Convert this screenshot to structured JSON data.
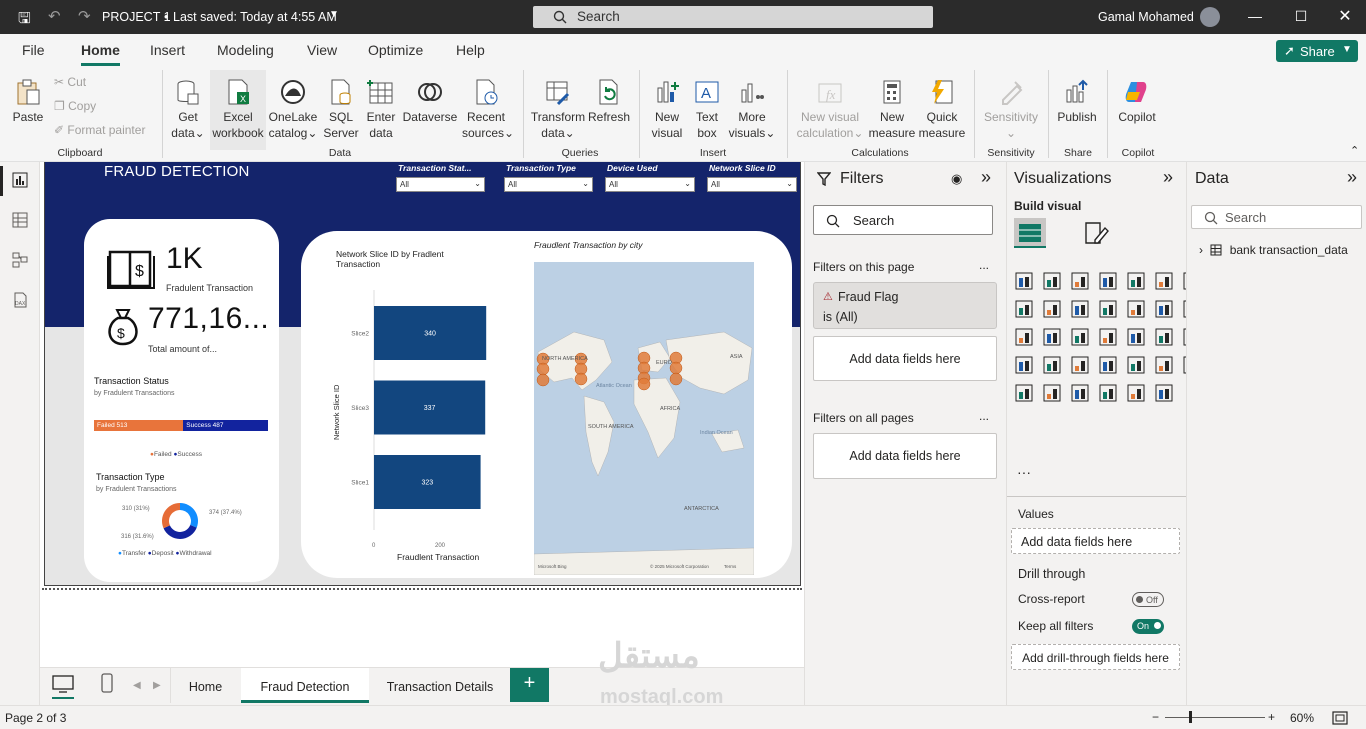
{
  "titlebar": {
    "project": "PROJECT 1",
    "saved": "Last saved: Today at 4:55 AM",
    "search_placeholder": "Search",
    "user": "Gamal Mohamed"
  },
  "menu": [
    "File",
    "Home",
    "Insert",
    "Modeling",
    "View",
    "Optimize",
    "Help"
  ],
  "share_label": "Share",
  "ribbon": {
    "paste": "Paste",
    "cut": "Cut",
    "copy": "Copy",
    "format_painter": "Format painter",
    "get_data": [
      "Get",
      "data"
    ],
    "excel": [
      "Excel",
      "workbook"
    ],
    "onelake": [
      "OneLake",
      "catalog"
    ],
    "sql": [
      "SQL",
      "Server"
    ],
    "enter": [
      "Enter",
      "data"
    ],
    "dataverse": "Dataverse",
    "recent": [
      "Recent",
      "sources"
    ],
    "transform": [
      "Transform",
      "data"
    ],
    "refresh": "Refresh",
    "new_visual": [
      "New",
      "visual"
    ],
    "text_box": [
      "Text",
      "box"
    ],
    "more_visuals": [
      "More",
      "visuals"
    ],
    "new_visual_calc": [
      "New visual",
      "calculation"
    ],
    "new_measure": [
      "New",
      "measure"
    ],
    "quick_measure": [
      "Quick",
      "measure"
    ],
    "sensitivity": "Sensitivity",
    "publish": "Publish",
    "copilot": "Copilot",
    "groups": [
      "Clipboard",
      "Data",
      "Queries",
      "Insert",
      "Calculations",
      "Sensitivity",
      "Share",
      "Copilot"
    ]
  },
  "report": {
    "title": "FRAUD DETECTION",
    "slicers": [
      {
        "label": "Transaction Stat...",
        "value": "All"
      },
      {
        "label": "Transaction Type",
        "value": "All"
      },
      {
        "label": "Device Used",
        "value": "All"
      },
      {
        "label": "Network Slice ID",
        "value": "All"
      }
    ],
    "kpi1": {
      "value": "1K",
      "label": "Fradulent Transaction"
    },
    "kpi2": {
      "value": "771,16...",
      "label": "Total amount of..."
    },
    "status": {
      "title": "Transaction Status",
      "subtitle": "by Fradulent Transactions",
      "failed_label": "Failed 513",
      "success_label": "Success 487",
      "failed": 513,
      "success": 487,
      "legend": [
        "Failed",
        "Success"
      ],
      "colors": [
        "#e8743b",
        "#12239e"
      ]
    },
    "type": {
      "title": "Transaction Type",
      "subtitle": "by Fradulent Transactions",
      "labels": [
        "310 (31%)",
        "374 (37.4%)",
        "316 (31.6%)"
      ],
      "legend": [
        "Transfer",
        "Deposit",
        "Withdrawal"
      ],
      "colors": [
        "#118dff",
        "#12239e",
        "#e66c37"
      ]
    },
    "bar": {
      "title": "Network Slice ID by Fradlent Transaction",
      "xlabel": "Fraudlent Transaction",
      "ylabel": "Network Slice ID",
      "ticks": [
        "0",
        "200"
      ]
    },
    "map": {
      "title": "Fraudlent Transaction by city",
      "labels": [
        "NORTH AMERICA",
        "EURO",
        "ASIA",
        "Atlantic Ocean",
        "AFRICA",
        "SOUTH AMERICA",
        "Indian Ocean",
        "ANTARCTICA"
      ],
      "footer_left": "Microsoft Bing",
      "footer_right": "© 2025 Microsoft Corporation",
      "terms": "Terms"
    }
  },
  "chart_data": {
    "type": "bar",
    "title": "Network Slice ID by Fradlent Transaction",
    "xlabel": "Fraudlent Transaction",
    "ylabel": "Network Slice ID",
    "categories": [
      "Slice2",
      "Slice3",
      "Slice1"
    ],
    "values": [
      340,
      337,
      323
    ],
    "xlim": [
      0,
      400
    ],
    "color": "#12467f"
  },
  "filters": {
    "title": "Filters",
    "search": "Search",
    "on_page": "Filters on this page",
    "flag_name": "Fraud Flag",
    "flag_value": "is (All)",
    "add_fields": "Add data fields here",
    "on_all": "Filters on all pages",
    "more": "..."
  },
  "viz": {
    "title": "Visualizations",
    "build": "Build visual",
    "values": "Values",
    "add_fields": "Add data fields here",
    "drill": "Drill through",
    "cross": "Cross-report",
    "cross_state": "Off",
    "keep": "Keep all filters",
    "keep_state": "On",
    "add_drill": "Add drill-through fields here",
    "ellipsis": "···"
  },
  "data": {
    "title": "Data",
    "search": "Search",
    "table": "bank transaction_data"
  },
  "tabs": [
    "Home",
    "Fraud Detection",
    "Transaction Details"
  ],
  "add_tab": "+",
  "status": {
    "page": "Page 2 of 3",
    "zoom": "60%",
    "minus": "−",
    "plus": "+"
  }
}
